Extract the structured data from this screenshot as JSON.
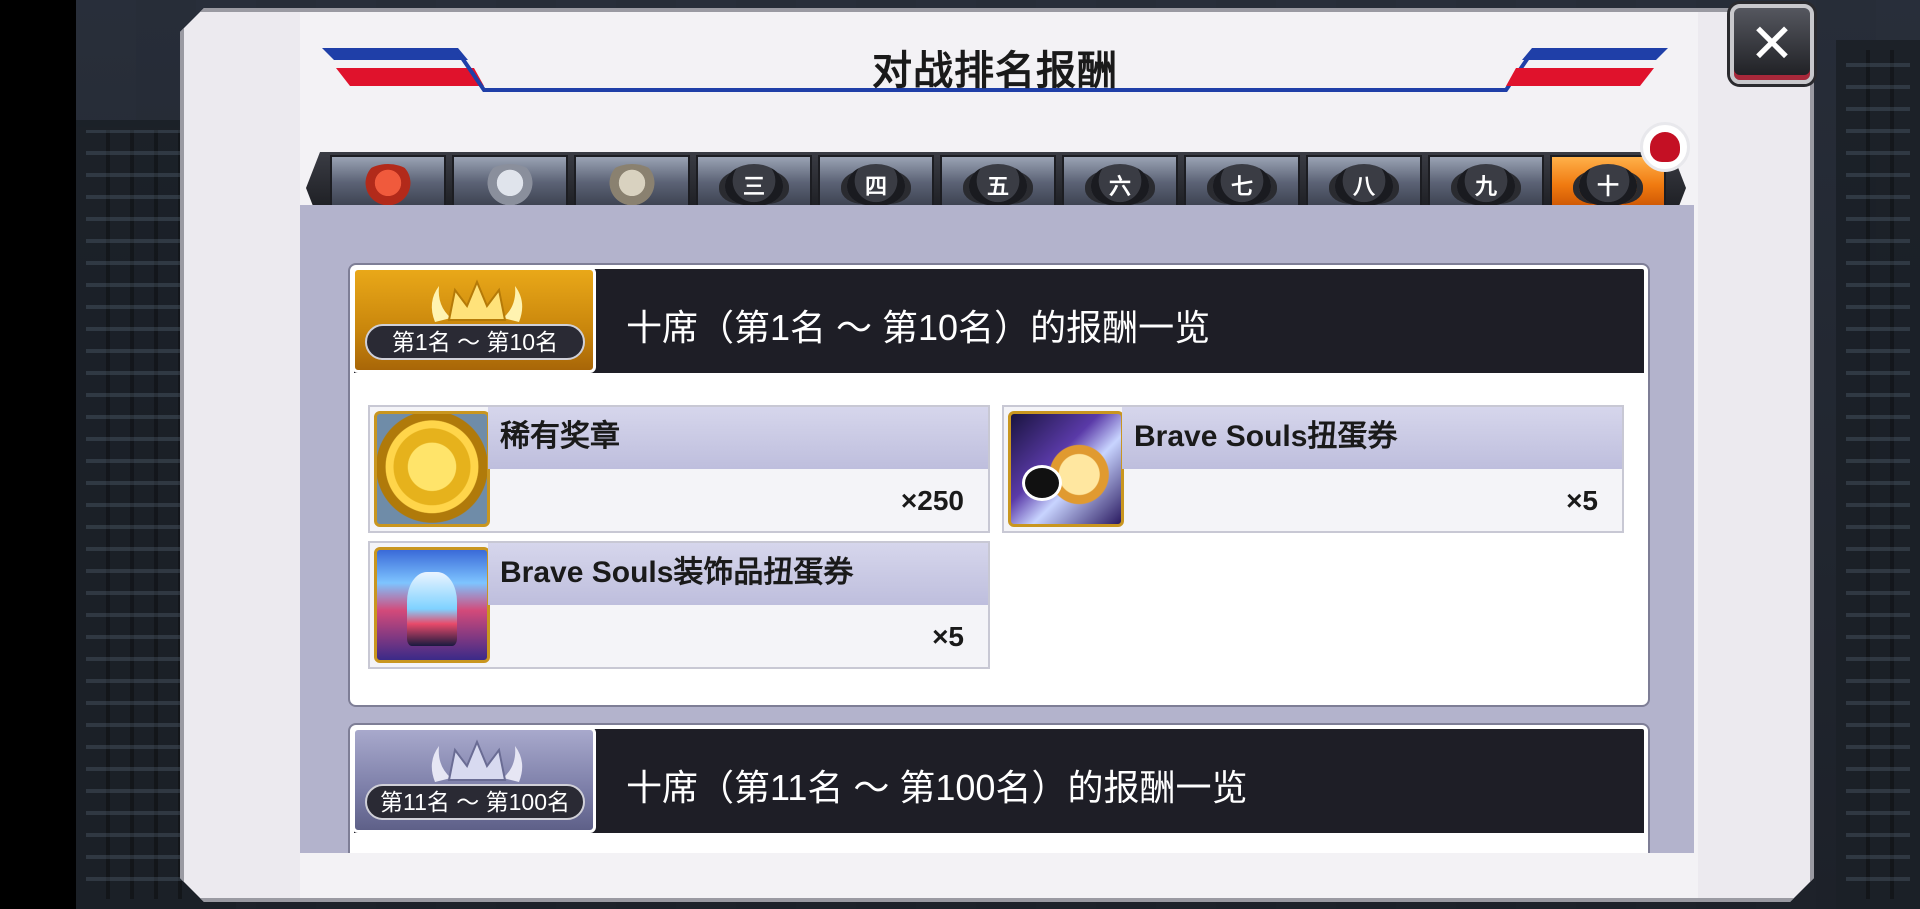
{
  "dialog": {
    "title": "对战排名报酬",
    "close_glyph": "✕"
  },
  "tabs": [
    {
      "id": "rank-1",
      "label": "",
      "icon": "rank-emblem-red-icon",
      "active": false
    },
    {
      "id": "rank-2",
      "label": "",
      "icon": "rank-emblem-silver-icon",
      "active": false
    },
    {
      "id": "rank-3",
      "label": "",
      "icon": "rank-emblem-bronze-icon",
      "active": false
    },
    {
      "id": "seat-3",
      "label": "三",
      "active": false
    },
    {
      "id": "seat-4",
      "label": "四",
      "active": false
    },
    {
      "id": "seat-5",
      "label": "五",
      "active": false
    },
    {
      "id": "seat-6",
      "label": "六",
      "active": false
    },
    {
      "id": "seat-7",
      "label": "七",
      "active": false
    },
    {
      "id": "seat-8",
      "label": "八",
      "active": false
    },
    {
      "id": "seat-9",
      "label": "九",
      "active": false
    },
    {
      "id": "seat-10",
      "label": "十",
      "active": true
    }
  ],
  "sections": [
    {
      "badge": "第1名 ～ 第10名",
      "title": "十席（第1名 ～ 第10名）的报酬一览",
      "badge_color": "gold",
      "rewards": [
        {
          "name": "稀有奖章",
          "qty": "×250",
          "icon": "rare-medal-icon"
        },
        {
          "name": "Brave Souls扭蛋券",
          "qty": "×5",
          "icon": "gacha-ticket-icon"
        },
        {
          "name": "Brave Souls装饰品扭蛋券",
          "qty": "×5",
          "icon": "accessory-gacha-ticket-icon"
        }
      ]
    },
    {
      "badge": "第11名 ～ 第100名",
      "title": "十席（第11名 ～ 第100名）的报酬一览",
      "badge_color": "silver",
      "rewards": []
    }
  ],
  "colors": {
    "accent_orange": "#f07a10",
    "title_blue": "#1f3fa8",
    "title_red": "#e0122c",
    "gold_badge": "#c9860c",
    "silver_badge": "#7c7ea8"
  }
}
